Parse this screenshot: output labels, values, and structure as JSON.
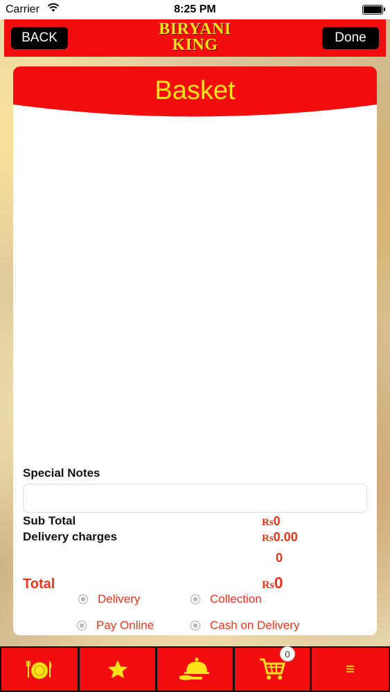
{
  "status_bar": {
    "carrier": "Carrier",
    "time": "8:25 PM"
  },
  "navbar": {
    "back_label": "BACK",
    "done_label": "Done",
    "logo_line1": "BIRYANI",
    "logo_line2": "KING"
  },
  "basket": {
    "title": "Basket",
    "special_notes_label": "Special Notes",
    "special_notes_value": "",
    "subtotal_label": "Sub Total",
    "subtotal_currency": "Rs",
    "subtotal_value": "0",
    "delivery_label": "Delivery charges",
    "delivery_currency": "Rs",
    "delivery_value": "0.00",
    "extra_value": "0",
    "total_label": "Total",
    "total_currency": "Rs",
    "total_value": "0"
  },
  "options": {
    "delivery": "Delivery",
    "collection": "Collection",
    "pay_online": "Pay Online",
    "cash_on_delivery": "Cash on Delivery"
  },
  "tabbar": {
    "cart_count": "0",
    "icons": [
      "food-plate-icon",
      "star-icon",
      "cloche-icon",
      "cart-icon",
      "menu-icon"
    ]
  },
  "colors": {
    "brand_red": "#f20e0e",
    "brand_yellow": "#ffe21a",
    "accent_text": "#e8351b"
  }
}
